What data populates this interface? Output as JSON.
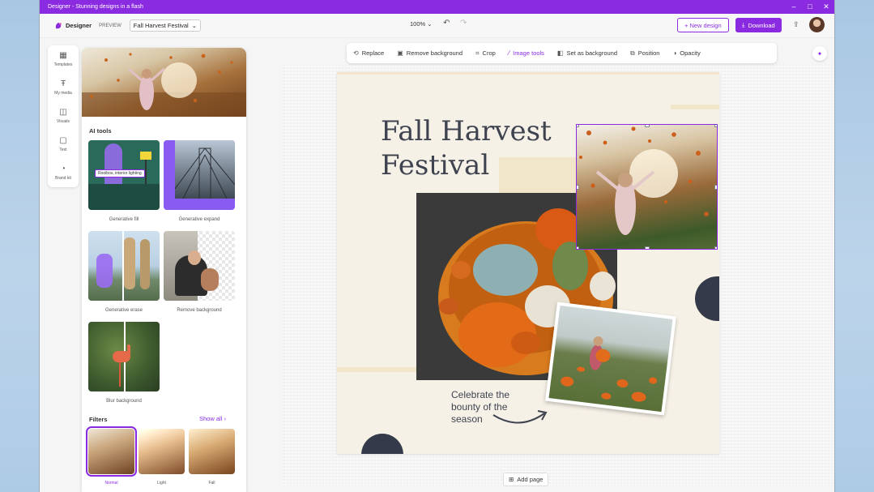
{
  "window": {
    "title": "Designer - Stunning designs in a flash"
  },
  "appbar": {
    "brand": "Designer",
    "badge": "PREVIEW",
    "doc_name": "Fall Harvest Festival",
    "zoom": "100%",
    "new_design": "+ New design",
    "download": "Download"
  },
  "rail": {
    "items": [
      {
        "label": "Templates",
        "icon": "templates-icon"
      },
      {
        "label": "My media",
        "icon": "text-icon"
      },
      {
        "label": "Visuals",
        "icon": "visuals-icon"
      },
      {
        "label": "Text",
        "icon": "book-icon"
      },
      {
        "label": "Brand kit",
        "icon": "palette-icon"
      }
    ]
  },
  "panel": {
    "ai_tools_title": "AI tools",
    "tools": [
      {
        "label": "Generative fill",
        "prompt": "Rooibos, interior lighting"
      },
      {
        "label": "Generative expand"
      },
      {
        "label": "Generative erase"
      },
      {
        "label": "Remove background"
      },
      {
        "label": "Blur background"
      }
    ],
    "filters_title": "Filters",
    "show_all": "Show all",
    "filters": [
      {
        "label": "Normal"
      },
      {
        "label": "Light"
      },
      {
        "label": "Fall"
      }
    ]
  },
  "context_toolbar": {
    "items": [
      {
        "label": "Replace",
        "icon": "replace-icon"
      },
      {
        "label": "Remove background",
        "icon": "remove-background-icon"
      },
      {
        "label": "Crop",
        "icon": "crop-icon"
      },
      {
        "label": "Image tools",
        "icon": "wand-icon",
        "active": true
      },
      {
        "label": "Set as background",
        "icon": "set-background-icon"
      },
      {
        "label": "Position",
        "icon": "position-icon"
      },
      {
        "label": "Opacity",
        "icon": "opacity-icon"
      }
    ]
  },
  "canvas": {
    "title_line1": "Fall Harvest",
    "title_line2": "Festival",
    "tagline": "Celebrate the bounty of the season",
    "add_page": "Add page"
  },
  "colors": {
    "accent": "#8a2be2",
    "title_text": "#3f4350",
    "dark_shape": "#353a4a"
  }
}
